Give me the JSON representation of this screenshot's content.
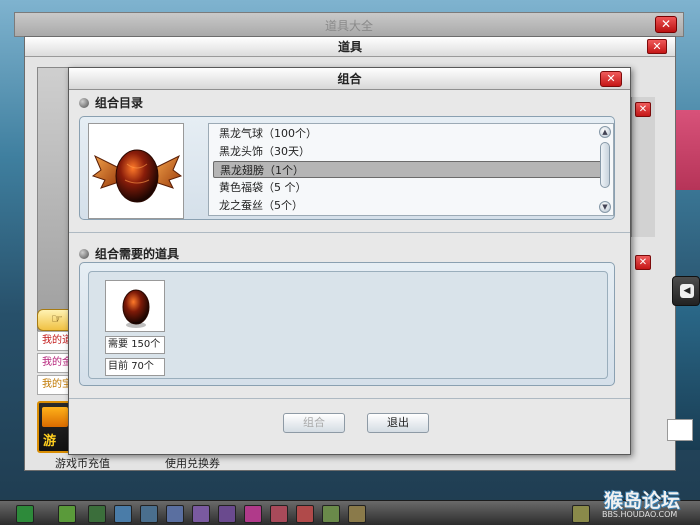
{
  "back_window": {
    "title": "道具大全",
    "close": "✕"
  },
  "items_window": {
    "title": "道具",
    "close": "✕",
    "hand_label": "☞",
    "links": [
      "我的道具",
      "我的金币",
      "我的宝物"
    ],
    "game_char": "游",
    "bottom_left": "游戏币充值",
    "bottom_right": "使用兑换券"
  },
  "right_side": {
    "close_top": "✕",
    "close_bottom": "✕",
    "arrow": "◀"
  },
  "dialog": {
    "title": "组合",
    "close": "✕",
    "catalog_title": "组合目录",
    "catalog_items": [
      "黑龙气球（100个）",
      "黑龙头饰（30天）",
      "黑龙翅膀（1个）",
      "黄色福袋（5 个）",
      "龙之蚕丝（5个）"
    ],
    "selected_index": 2,
    "needed_title": "组合需要的道具",
    "need_label": "需要",
    "need_value": "150个",
    "have_label": "目前",
    "have_value": "70个",
    "combine_button": "组合",
    "combine_enabled": false,
    "exit_button": "退出",
    "scroll_up": "▲",
    "scroll_down": "▼"
  },
  "watermark": {
    "text": "猴岛论坛",
    "sub": "BBS.HOUDAO.COM"
  },
  "colors": {
    "accent_red": "#c51717",
    "panel_blue": "#d5e0ea",
    "selected": "#b5b5b5"
  }
}
